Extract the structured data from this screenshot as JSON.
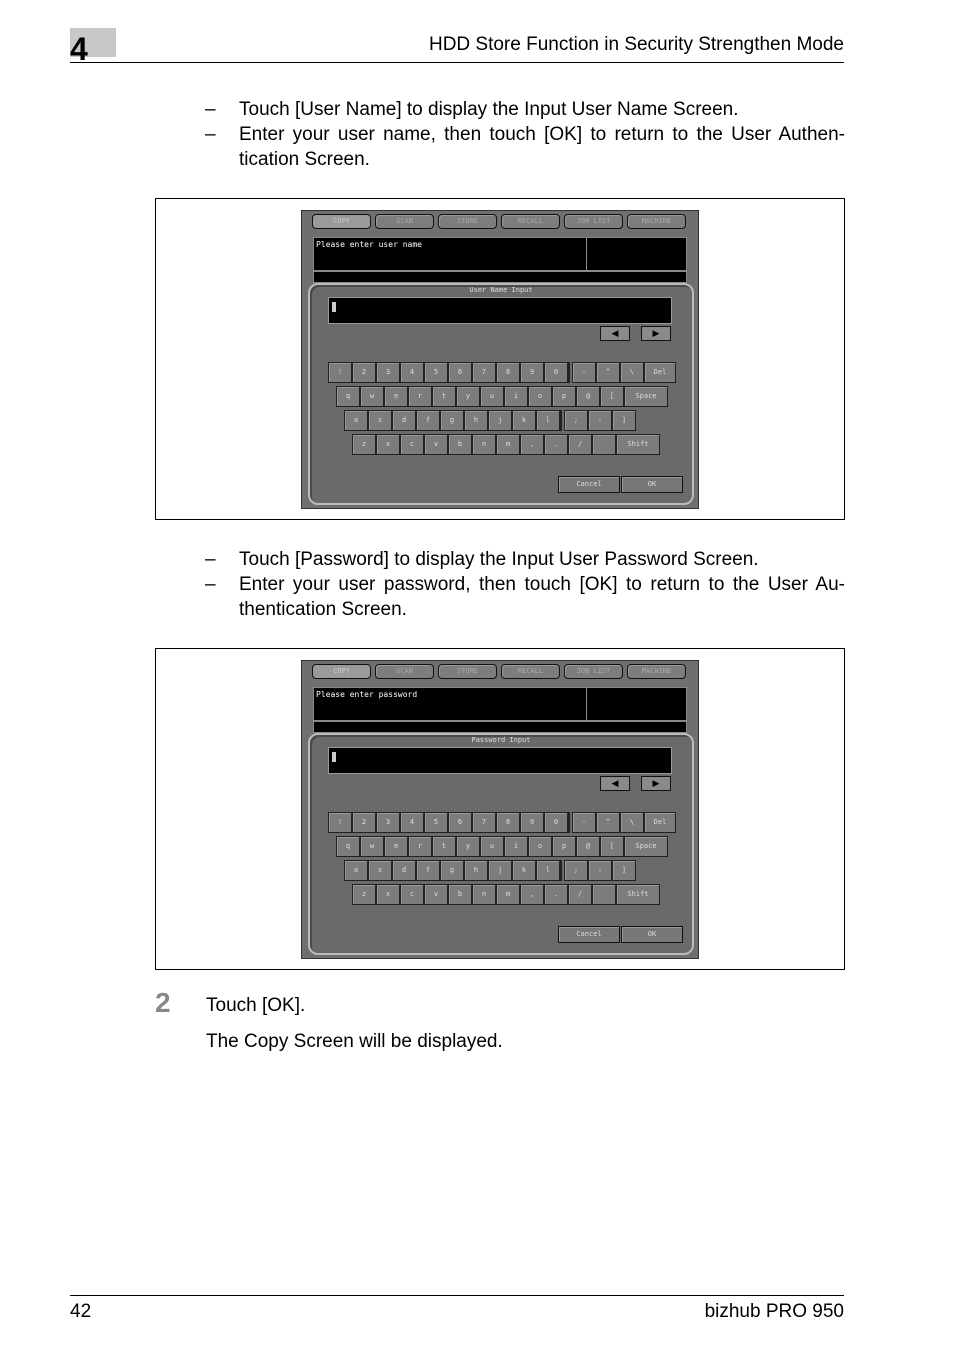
{
  "header": {
    "chapter": "4",
    "title": "HDD Store Function in Security Strengthen Mode"
  },
  "section1": {
    "bullets": [
      "Touch [User Name] to display the Input User Name Screen.",
      "Enter your user name, then touch [OK] to return to the User Authen-tication Screen."
    ]
  },
  "section2": {
    "bullets": [
      "Touch [Password] to display the Input User Password Screen.",
      "Enter your user password, then touch [OK] to return to the User Au-thentication Screen."
    ]
  },
  "screen1": {
    "tabs": [
      "COPY",
      "SCAN",
      "STORE",
      "RECALL",
      "JOB LIST",
      "MACHINE"
    ],
    "message": "Please enter user name",
    "panel_title": "User Name Input",
    "arrows": [
      "◀",
      "▶"
    ],
    "keys": {
      "row1": [
        "!",
        "2",
        "3",
        "4",
        "5",
        "6",
        "7",
        "8",
        "9",
        "0",
        "-",
        "^",
        "\\",
        "Del"
      ],
      "row2": [
        "q",
        "w",
        "e",
        "r",
        "t",
        "y",
        "u",
        "i",
        "o",
        "p",
        "@",
        "[",
        "Space"
      ],
      "row3": [
        "a",
        "s",
        "d",
        "f",
        "g",
        "h",
        "j",
        "k",
        "l",
        ";",
        ":",
        "]"
      ],
      "row4": [
        "z",
        "x",
        "c",
        "v",
        "b",
        "n",
        "m",
        ",",
        ".",
        "/",
        "",
        "Shift"
      ]
    },
    "cancel": "Cancel",
    "ok": "OK"
  },
  "screen2": {
    "tabs": [
      "COPY",
      "SCAN",
      "STORE",
      "RECALL",
      "JOB LIST",
      "MACHINE"
    ],
    "message": "Please enter password",
    "panel_title": "Password Input",
    "arrows": [
      "◀",
      "▶"
    ],
    "keys": {
      "row1": [
        "!",
        "2",
        "3",
        "4",
        "5",
        "6",
        "7",
        "8",
        "9",
        "0",
        "-",
        "^",
        "\\",
        "Del"
      ],
      "row2": [
        "q",
        "w",
        "e",
        "r",
        "t",
        "y",
        "u",
        "i",
        "o",
        "p",
        "@",
        "[",
        "Space"
      ],
      "row3": [
        "a",
        "s",
        "d",
        "f",
        "g",
        "h",
        "j",
        "k",
        "l",
        ";",
        ":",
        "]"
      ],
      "row4": [
        "z",
        "x",
        "c",
        "v",
        "b",
        "n",
        "m",
        ",",
        ".",
        "/",
        "",
        "Shift"
      ]
    },
    "cancel": "Cancel",
    "ok": "OK"
  },
  "step": {
    "number": "2",
    "instruction": "Touch [OK].",
    "result": "The Copy Screen will be displayed."
  },
  "footer": {
    "page": "42",
    "product": "bizhub PRO 950"
  }
}
